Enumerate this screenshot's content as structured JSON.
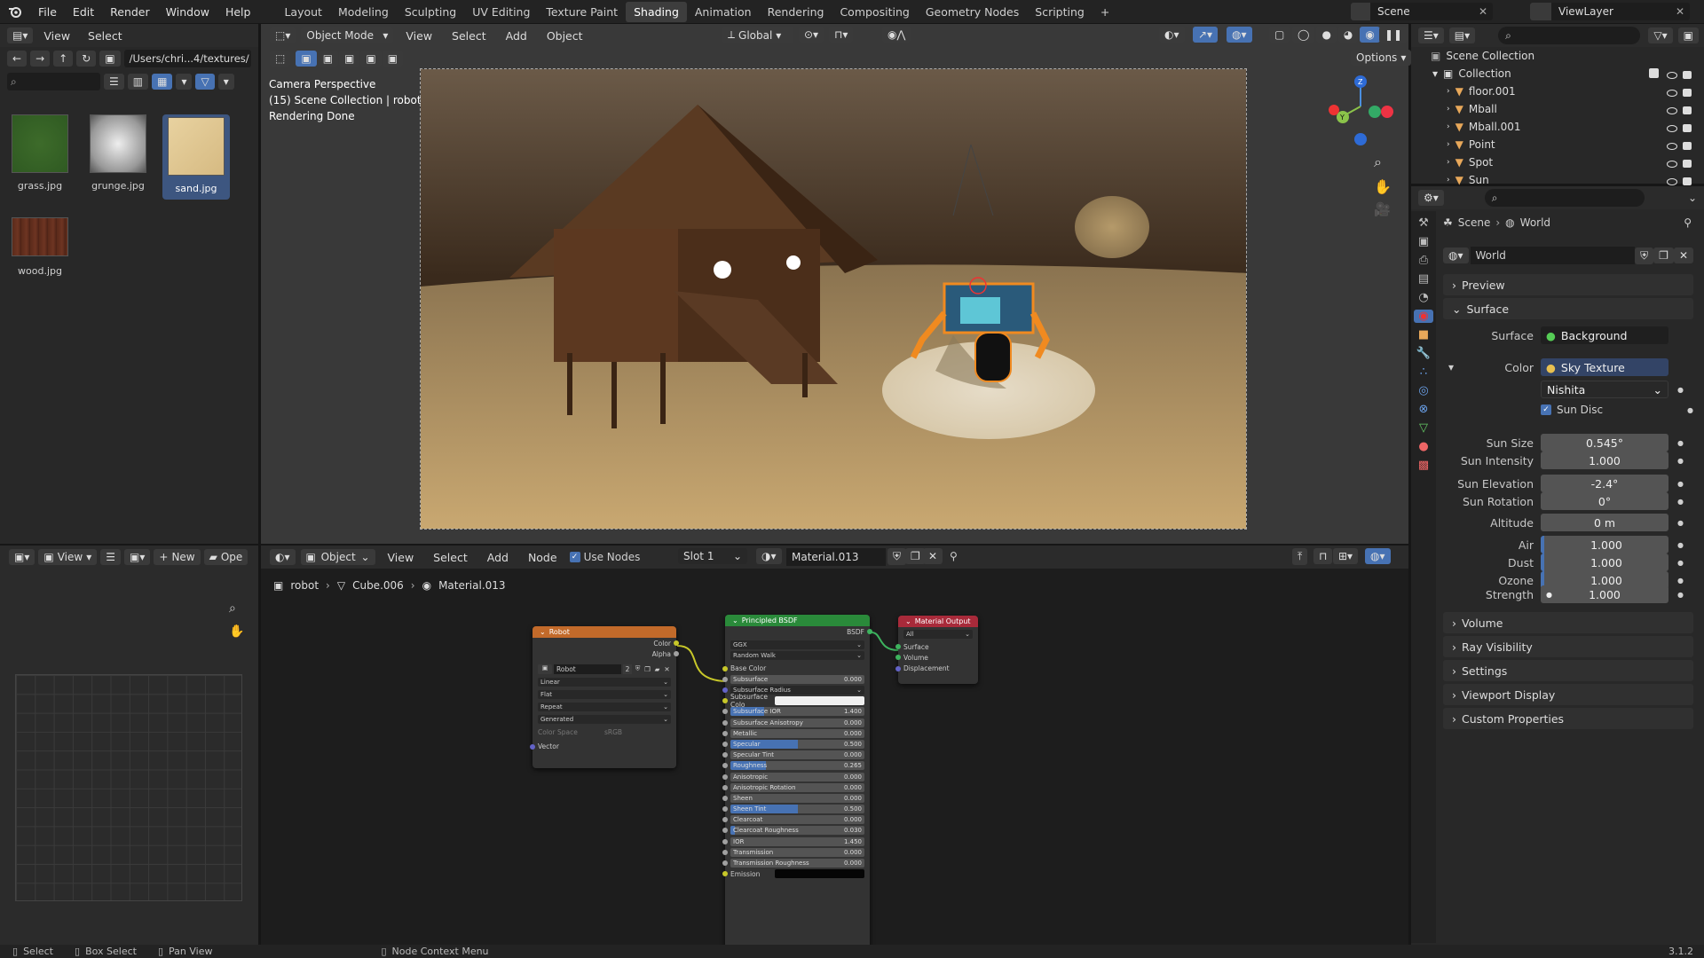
{
  "menubar": {
    "items": [
      "File",
      "Edit",
      "Render",
      "Window",
      "Help"
    ],
    "workspaces": [
      "Layout",
      "Modeling",
      "Sculpting",
      "UV Editing",
      "Texture Paint",
      "Shading",
      "Animation",
      "Rendering",
      "Compositing",
      "Geometry Nodes",
      "Scripting"
    ],
    "active_workspace": "Shading",
    "add_tab": "+",
    "scene": "Scene",
    "view_layer": "ViewLayer"
  },
  "file_browser": {
    "menu": [
      "View",
      "Select"
    ],
    "path": "/Users/chri...4/textures/",
    "files": [
      {
        "name": "grass.jpg"
      },
      {
        "name": "grunge.jpg"
      },
      {
        "name": "sand.jpg",
        "selected": true
      },
      {
        "name": "wood.jpg"
      }
    ]
  },
  "viewport": {
    "mode": "Object Mode",
    "menu": [
      "View",
      "Select",
      "Add",
      "Object"
    ],
    "transform": "Global",
    "options": "Options",
    "info": [
      "Camera Perspective",
      "(15) Scene Collection | robot",
      "Rendering Done"
    ]
  },
  "outliner": {
    "title": "Scene Collection",
    "collection": "Collection",
    "items": [
      {
        "name": "floor.001",
        "icon": "mesh-icon",
        "color": "#e8a85a"
      },
      {
        "name": "Mball",
        "icon": "mball-icon",
        "color": "#e8a85a"
      },
      {
        "name": "Mball.001",
        "icon": "mball-icon",
        "color": "#e8a85a"
      },
      {
        "name": "Point",
        "icon": "light-icon",
        "color": "#e8a85a"
      },
      {
        "name": "Spot",
        "icon": "light-icon",
        "color": "#e8a85a"
      },
      {
        "name": "Sun",
        "icon": "light-icon",
        "color": "#e8a85a"
      }
    ]
  },
  "properties": {
    "breadcrumb": [
      "Scene",
      "World"
    ],
    "world_name": "World",
    "sections": {
      "preview": "Preview",
      "surface": "Surface",
      "volume": "Volume",
      "ray_visibility": "Ray Visibility",
      "settings": "Settings",
      "viewport_display": "Viewport Display",
      "custom_properties": "Custom Properties"
    },
    "surface_label": "Surface",
    "surface_value": "Background",
    "color_label": "Color",
    "color_value": "Sky Texture",
    "sky_type": "Nishita",
    "sun_disc": "Sun Disc",
    "params": [
      {
        "label": "Sun Size",
        "value": "0.545°"
      },
      {
        "label": "Sun Intensity",
        "value": "1.000"
      },
      {
        "label": "Sun Elevation",
        "value": "-2.4°"
      },
      {
        "label": "Sun Rotation",
        "value": "0°"
      },
      {
        "label": "Altitude",
        "value": "0 m"
      },
      {
        "label": "Air",
        "value": "1.000"
      },
      {
        "label": "Dust",
        "value": "1.000"
      },
      {
        "label": "Ozone",
        "value": "1.000"
      }
    ],
    "strength_label": "Strength",
    "strength_value": "1.000"
  },
  "image_editor": {
    "view": "View",
    "new": "New",
    "open": "Ope"
  },
  "node_editor": {
    "object": "Object",
    "menu": [
      "View",
      "Select",
      "Add",
      "Node"
    ],
    "use_nodes": "Use Nodes",
    "slot": "Slot 1",
    "material": "Material.013",
    "breadcrumb": [
      "robot",
      "Cube.006",
      "Material.013"
    ],
    "image_node": {
      "title": "Robot",
      "outputs": [
        "Color",
        "Alpha"
      ],
      "image": "Robot",
      "users": "2",
      "options": [
        "Linear",
        "Flat",
        "Repeat",
        "Generated"
      ],
      "colorspace_label": "Color Space",
      "colorspace": "sRGB",
      "vector": "Vector"
    },
    "bsdf": {
      "title": "Principled BSDF",
      "output": "BSDF",
      "distribution": "GGX",
      "subsurface_method": "Random Walk",
      "base_color": "Base Color",
      "rows": [
        {
          "label": "Subsurface",
          "value": "0.000",
          "fill": 0
        },
        {
          "label": "Subsurface Radius",
          "value": "",
          "dd": true
        },
        {
          "label": "Subsurface Colo",
          "value": "",
          "color": "#f0f0f0"
        },
        {
          "label": "Subsurface IOR",
          "value": "1.400",
          "fill": 0.25
        },
        {
          "label": "Subsurface Anisotropy",
          "value": "0.000",
          "fill": 0
        },
        {
          "label": "Metallic",
          "value": "0.000",
          "fill": 0
        },
        {
          "label": "Specular",
          "value": "0.500",
          "fill": 0.5
        },
        {
          "label": "Specular Tint",
          "value": "0.000",
          "fill": 0
        },
        {
          "label": "Roughness",
          "value": "0.265",
          "fill": 0.265
        },
        {
          "label": "Anisotropic",
          "value": "0.000",
          "fill": 0
        },
        {
          "label": "Anisotropic Rotation",
          "value": "0.000",
          "fill": 0
        },
        {
          "label": "Sheen",
          "value": "0.000",
          "fill": 0
        },
        {
          "label": "Sheen Tint",
          "value": "0.500",
          "fill": 0.5
        },
        {
          "label": "Clearcoat",
          "value": "0.000",
          "fill": 0
        },
        {
          "label": "Clearcoat Roughness",
          "value": "0.030",
          "fill": 0.03
        },
        {
          "label": "IOR",
          "value": "1.450",
          "fill": 0
        },
        {
          "label": "Transmission",
          "value": "0.000",
          "fill": 0
        },
        {
          "label": "Transmission Roughness",
          "value": "0.000",
          "fill": 0
        },
        {
          "label": "Emission",
          "value": "",
          "color": "#050505"
        }
      ]
    },
    "output": {
      "title": "Material Output",
      "target": "All",
      "inputs": [
        "Surface",
        "Volume",
        "Displacement"
      ]
    }
  },
  "statusbar": {
    "select": "Select",
    "box_select": "Box Select",
    "pan_view": "Pan View",
    "context_menu": "Node Context Menu",
    "version": "3.1.2"
  },
  "colors": {
    "accent": "#4772b3",
    "header": "#2b2b2b",
    "panel": "#282828",
    "image_node": "#c26a2a",
    "bsdf_node": "#2a8a3a",
    "output_node": "#a82a3a"
  }
}
